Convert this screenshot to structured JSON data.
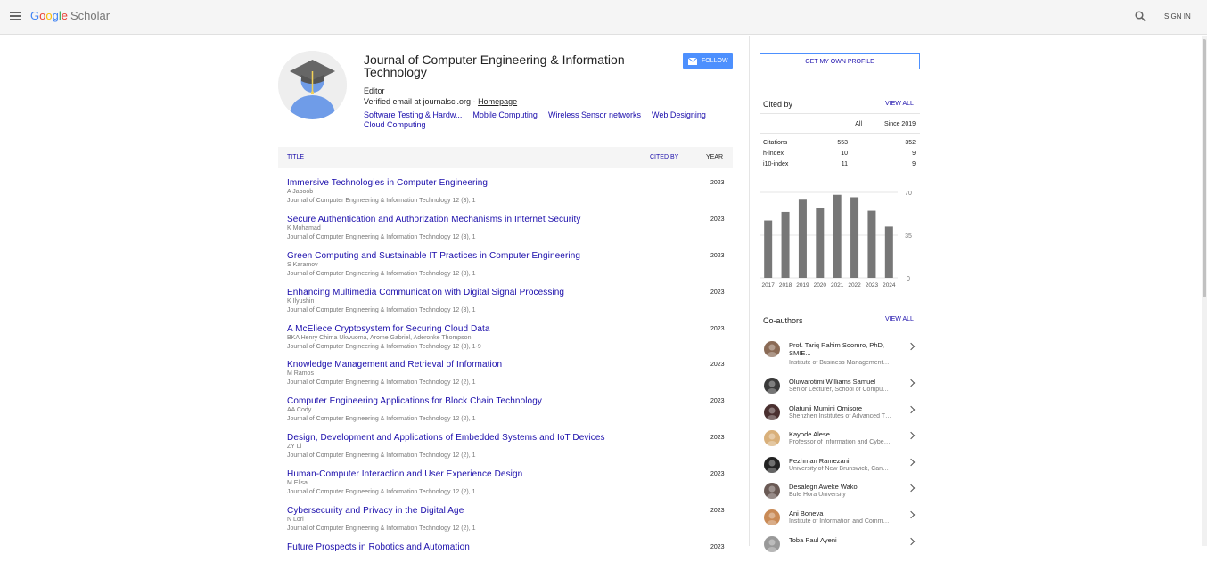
{
  "header": {
    "logo_google": [
      "G",
      "o",
      "o",
      "g",
      "l",
      "e"
    ],
    "logo_scholar": "Scholar",
    "signin": "SIGN IN"
  },
  "profile": {
    "name": "Journal of Computer Engineering & Information Technology",
    "affiliation": "Editor",
    "email_prefix": "Verified email at journalsci.org - ",
    "homepage": "Homepage",
    "interests": [
      "Software Testing & Hardw...",
      "Mobile Computing",
      "Wireless Sensor networks",
      "Web Designing",
      "Cloud Computing"
    ],
    "follow": "FOLLOW"
  },
  "table": {
    "title_header": "TITLE",
    "cited_header": "CITED BY",
    "year_header": "YEAR",
    "rows": [
      {
        "title": "Immersive Technologies in Computer Engineering",
        "authors": "A Jaboob",
        "venue": "Journal of Computer Engineering & Information Technology 12 (3), 1",
        "year": "2023"
      },
      {
        "title": "Secure Authentication and Authorization Mechanisms in Internet Security",
        "authors": "K Mohamad",
        "venue": "Journal of Computer Engineering & Information Technology 12 (3), 1",
        "year": "2023"
      },
      {
        "title": "Green Computing and Sustainable IT Practices in Computer Engineering",
        "authors": "S Karamov",
        "venue": "Journal of Computer Engineering & Information Technology 12 (3), 1",
        "year": "2023"
      },
      {
        "title": "Enhancing Multimedia Communication with Digital Signal Processing",
        "authors": "K Ilyushin",
        "venue": "Journal of Computer Engineering & Information Technology 12 (3), 1",
        "year": "2023"
      },
      {
        "title": "A McEliece Cryptosystem for Securing Cloud Data",
        "authors": "BKA Henry Chima Ukwuoma, Arome Gabriel, Aderonke Thompson",
        "venue": "Journal of Computer Engineering & Information Technology 12 (3), 1-9",
        "year": "2023"
      },
      {
        "title": "Knowledge Management and Retrieval of Information",
        "authors": "M Ramos",
        "venue": "Journal of Computer Engineering & Information Technology 12 (2), 1",
        "year": "2023"
      },
      {
        "title": "Computer Engineering Applications for Block Chain Technology",
        "authors": "AA Cody",
        "venue": "Journal of Computer Engineering & Information Technology 12 (2), 1",
        "year": "2023"
      },
      {
        "title": "Design, Development and Applications of Embedded Systems and IoT Devices",
        "authors": "ZY Li",
        "venue": "Journal of Computer Engineering & Information Technology 12 (2), 1",
        "year": "2023"
      },
      {
        "title": "Human-Computer Interaction and User Experience Design",
        "authors": "M Elisa",
        "venue": "Journal of Computer Engineering & Information Technology 12 (2), 1",
        "year": "2023"
      },
      {
        "title": "Cybersecurity and Privacy in the Digital Age",
        "authors": "N Lori",
        "venue": "Journal of Computer Engineering & Information Technology 12 (2), 1",
        "year": "2023"
      },
      {
        "title": "Future Prospects in Robotics and Automation",
        "authors": "",
        "venue": "",
        "year": "2023"
      }
    ]
  },
  "sidebar": {
    "get_profile": "GET MY OWN PROFILE",
    "cited_by": "Cited by",
    "view_all": "VIEW ALL",
    "col_all": "All",
    "col_since": "Since 2019",
    "stats": [
      {
        "label": "Citations",
        "all": "553",
        "since": "352"
      },
      {
        "label": "h-index",
        "all": "10",
        "since": "9"
      },
      {
        "label": "i10-index",
        "all": "11",
        "since": "9"
      }
    ],
    "coauthors_title": "Co-authors",
    "coauthors": [
      {
        "name": "Prof. Tariq Rahim Soomro, PhD, SMIE...",
        "affil": "Institute of Business Management…",
        "color": "#8a6a55"
      },
      {
        "name": "Oluwarotimi Williams Samuel",
        "affil": "Senior Lecturer, School of Compu…",
        "color": "#3a3a3a"
      },
      {
        "name": "Olatunji Mumini Omisore",
        "affil": "Shenzhen Institutes of Advanced T…",
        "color": "#4a3030"
      },
      {
        "name": "Kayode Alese",
        "affil": "Professor of Information and Cybe…",
        "color": "#d9b07a"
      },
      {
        "name": "Pezhman Ramezani",
        "affil": "University of New Brunswick, Can…",
        "color": "#222222"
      },
      {
        "name": "Desalegn Aweke Wako",
        "affil": "Bule Hora University",
        "color": "#6a5a55"
      },
      {
        "name": "Ani Boneva",
        "affil": "Institute of Information and Comm…",
        "color": "#c98a55"
      },
      {
        "name": "Toba Paul Ayeni",
        "affil": "",
        "color": "#999999"
      }
    ]
  },
  "chart_data": {
    "type": "bar",
    "categories": [
      "2017",
      "2018",
      "2019",
      "2020",
      "2021",
      "2022",
      "2023",
      "2024"
    ],
    "values": [
      47,
      54,
      64,
      57,
      68,
      66,
      55,
      42
    ],
    "ylim": [
      0,
      70
    ],
    "yticks": [
      "70",
      "35",
      "0"
    ],
    "bar_color": "#777777"
  }
}
